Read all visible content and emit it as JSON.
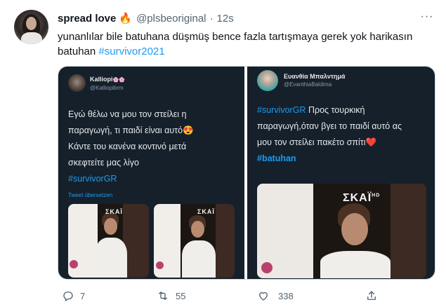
{
  "tweet": {
    "display_name": "spread love",
    "emoji": "🔥",
    "handle": "@plsbeoriginal",
    "separator": "·",
    "time": "12s",
    "more_label": "···",
    "text_plain": "yunanlılar bile batuhana düşmüş bence fazla tartışmaya gerek yok harikasın batuhan ",
    "text_hashtag": "#survivor2021"
  },
  "left_screenshot": {
    "name": "Kalliopi",
    "name_suffix": "🌸🌸",
    "handle": "@Kalliopibrm",
    "lines": [
      "Εγώ θέλω να μου τον στείλει η",
      "παραγωγή, τι παιδί είναι αυτό😍",
      "Κάντε του κανένα κοντινό μετά",
      "σκεφτείτε μας λίγο"
    ],
    "hashtag": "#survivorGR",
    "translate": "Tweet übersetzen",
    "logo_text": "ΣΚΑΪ"
  },
  "right_screenshot": {
    "name": "Ευανθία Μπαλντημά",
    "handle": "@EvanthiaBaldima",
    "hashtag_start": "#survivorGR",
    "line1_rest": " Προς τουρκική",
    "line2": "παραγωγή,όταν βγει το παιδί αυτό ας",
    "line3": "μου τον στείλει πακέτο σπίτι❤️",
    "hashtag_end": "#batuhan",
    "logo_text": "ΣΚΑΪ",
    "logo_sup": "HD"
  },
  "actions": {
    "reply_count": "7",
    "retweet_count": "55",
    "like_count": "338"
  },
  "colors": {
    "link": "#1d9bf0",
    "secondary": "#536471",
    "dark_panel": "#15202b"
  }
}
